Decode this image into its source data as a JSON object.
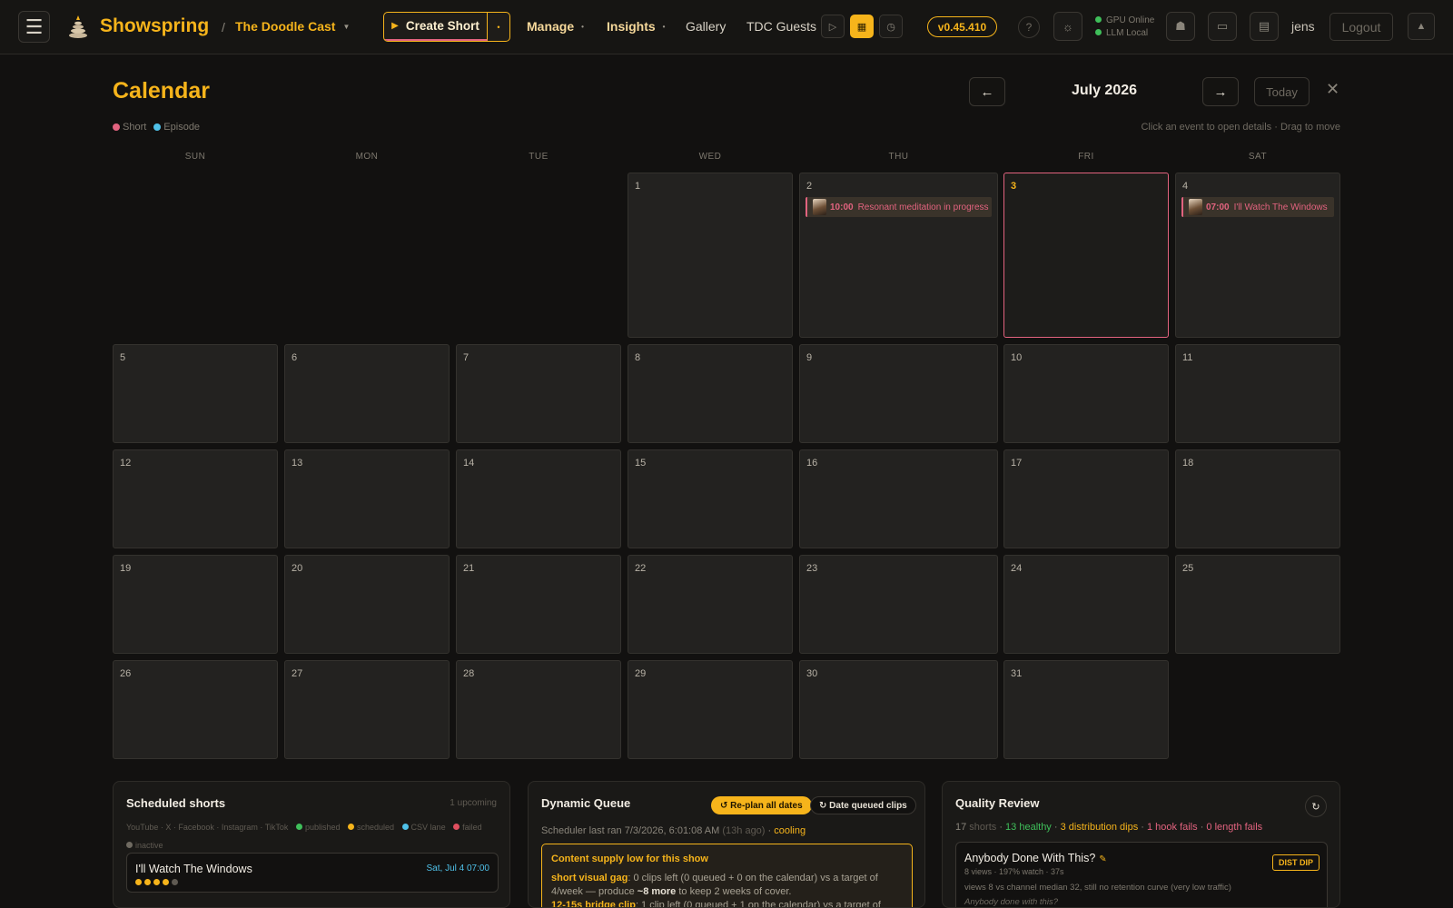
{
  "header": {
    "brand": "Showspring",
    "show_name": "The Doodle Cast",
    "create_label": "Create Short",
    "nav": {
      "manage": "Manage",
      "insights": "Insights",
      "gallery": "Gallery",
      "guests": "TDC Guests"
    },
    "version": "v0.45.410",
    "help": "?",
    "status": {
      "gpu": "GPU Online",
      "llm": "LLM Local"
    },
    "user": "jens",
    "logout": "Logout"
  },
  "calendar": {
    "title": "Calendar",
    "legend": {
      "short": "Short",
      "episode": "Episode"
    },
    "month_label": "July 2026",
    "prev": "←",
    "next": "→",
    "today": "Today",
    "close": "✕",
    "hint": "Click an event to open details · Drag to move",
    "weekdays": [
      "SUN",
      "MON",
      "TUE",
      "WED",
      "THU",
      "FRI",
      "SAT"
    ],
    "first_weekday": 3,
    "days_in_month": 31,
    "today_day": 3,
    "events": [
      {
        "day": 2,
        "time": "10:00",
        "title": "Resonant meditation in progress"
      },
      {
        "day": 4,
        "time": "07:00",
        "title": "I'll Watch The Windows"
      }
    ]
  },
  "colors": {
    "accent": "#f6b41b",
    "short": "#e2637f",
    "episode": "#4fc1e9",
    "published": "#3fbf5a",
    "scheduled": "#f6b41b",
    "csv_lane": "#4fc1e9",
    "failed": "#e04f5f",
    "inactive": "#6f6a61"
  },
  "scheduled": {
    "title": "Scheduled shorts",
    "count": "1 upcoming",
    "platforms": "YouTube · X · Facebook · Instagram · TikTok",
    "legend": {
      "published": "published",
      "scheduled": "scheduled",
      "csv": "CSV lane",
      "failed": "failed",
      "inactive": "inactive"
    },
    "item": {
      "title": "I'll Watch The Windows",
      "date": "Sat, Jul 4 07:00",
      "platform_states": [
        "scheduled",
        "scheduled",
        "scheduled",
        "scheduled",
        "inactive"
      ]
    }
  },
  "queue": {
    "title": "Dynamic Queue",
    "replan": "↺ Re-plan all dates",
    "date_clips": "↻ Date queued clips",
    "scheduler_text": "Scheduler last ran 7/3/2026, 6:01:08 AM",
    "ago": "(13h ago)",
    "sep": " · ",
    "state": "cooling",
    "warning_title": "Content supply low for this show",
    "line1_key": "short visual gag",
    "line1_text": ": 0 clips left (0 queued + 0 on the calendar) vs a target of 4/week — produce ",
    "line1_bold": "~8 more",
    "line1_tail": " to keep 2 weeks of cover.",
    "line2_key": "12-15s bridge clip",
    "line2_text": ": 1 clip left (0 queued + 1 on the calendar) vs a target of"
  },
  "quality": {
    "title": "Quality Review",
    "refresh": "↻",
    "stats": {
      "shorts": "17",
      "shorts_label": " shorts",
      "healthy": "13 healthy",
      "dips": "3 distribution dips",
      "hook": "1 hook fails",
      "length": "0 length fails",
      "sep": " · "
    },
    "card": {
      "title": "Anybody Done With This?",
      "badge": "DIST DIP",
      "sub": "8 views · 197% watch · 37s",
      "note": "views 8 vs channel median 32, still no retention curve (very low traffic)",
      "quote": "Anybody done with this?"
    }
  }
}
